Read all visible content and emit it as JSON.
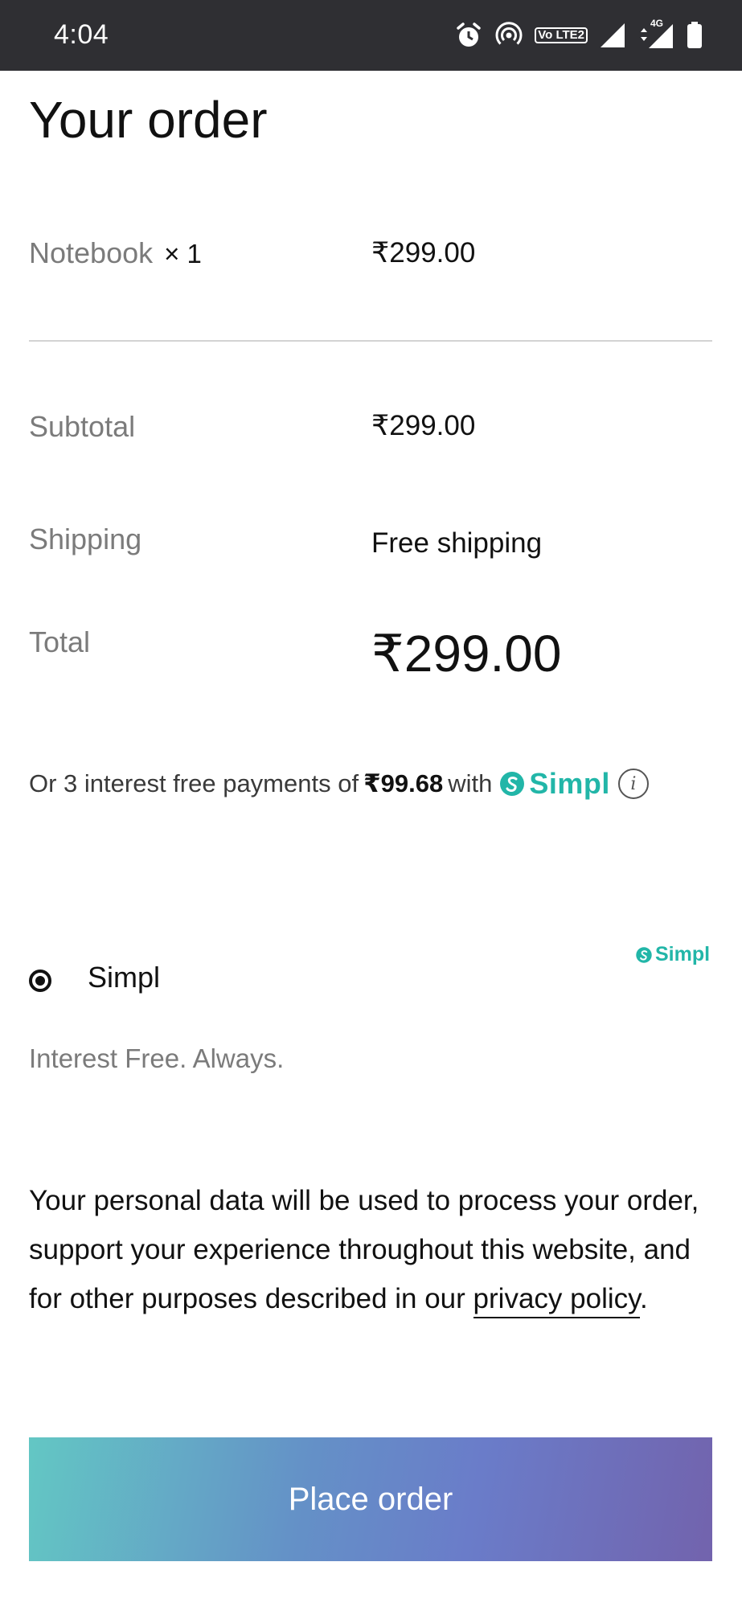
{
  "status_bar": {
    "time": "4:04",
    "icons": [
      "alarm-icon",
      "hotspot-icon",
      "volte-icon",
      "signal-icon",
      "data-4g-icon",
      "battery-icon"
    ],
    "volte_label": "Vo LTE2",
    "network_label": "4G"
  },
  "order": {
    "title": "Your order",
    "item_name": "Notebook",
    "item_qty": "× 1",
    "item_price": "₹299.00",
    "subtotal_label": "Subtotal",
    "subtotal_value": "₹299.00",
    "shipping_label": "Shipping",
    "shipping_value": "Free shipping",
    "total_label": "Total",
    "total_value": "₹299.00"
  },
  "installments": {
    "prefix": "Or 3 interest free payments of",
    "amount": "₹99.68",
    "suffix": "with",
    "brand": "Simpl",
    "info_glyph": "i"
  },
  "payment": {
    "method_label": "Simpl",
    "brand_logo": "Simpl",
    "description": "Interest Free. Always.",
    "selected": true
  },
  "privacy": {
    "text": "Your personal data will be used to process your order, support your experience throughout this website, and for other purposes described in our",
    "link_label": "privacy policy",
    "end": "."
  },
  "actions": {
    "place_order_label": "Place order"
  },
  "colors": {
    "status_bar_bg": "#2f2f33",
    "simpl_brand": "#22b6a8",
    "button_gradient_start": "#63c7c4",
    "button_gradient_end": "#7263ad",
    "muted_text": "#7b7b7b"
  }
}
